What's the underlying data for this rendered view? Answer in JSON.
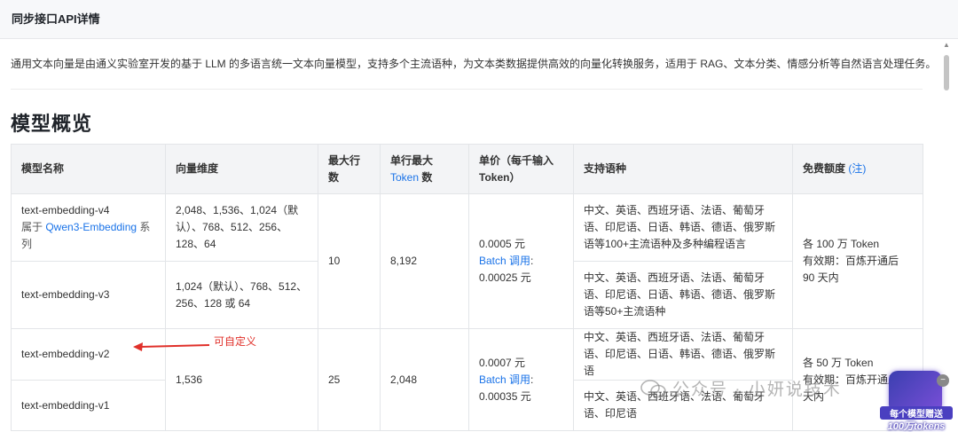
{
  "header": {
    "title": "同步接口API详情"
  },
  "intro": "通用文本向量是由通义实验室开发的基于 LLM 的多语言统一文本向量模型，支持多个主流语种，为文本类数据提供高效的向量化转换服务，适用于 RAG、文本分类、情感分析等自然语言处理任务。",
  "section_title": "模型概览",
  "table": {
    "headers": {
      "model": "模型名称",
      "dims": "向量维度",
      "max_rows": "最大行数",
      "max_tokens_pre": "单行最大",
      "max_tokens_link": "Token",
      "max_tokens_post": " 数",
      "price": "单价（每千输入 Token）",
      "langs": "支持语种",
      "quota_pre": "免费额度",
      "quota_link": "(注)"
    },
    "v4": {
      "name": "text-embedding-v4",
      "belongs_pre": "属于 ",
      "belongs_link": "Qwen3-Embedding",
      "belongs_post": " 系列",
      "dims": "2,048、1,536、1,024（默认）、768、512、256、128、64",
      "langs": "中文、英语、西班牙语、法语、葡萄牙语、印尼语、日语、韩语、德语、俄罗斯语等100+主流语种及多种编程语言"
    },
    "v3": {
      "name": "text-embedding-v3",
      "dims": "1,024（默认）、768、512、256、128 或 64",
      "langs": "中文、英语、西班牙语、法语、葡萄牙语、印尼语、日语、韩语、德语、俄罗斯语等50+主流语种"
    },
    "group1": {
      "max_rows": "10",
      "max_tokens": "8,192",
      "price": "0.0005 元",
      "batch_link": "Batch 调用",
      "batch_colon": ":",
      "batch_price": "0.00025 元",
      "quota": "各 100 万 Token",
      "valid": "有效期：百炼开通后 90 天内"
    },
    "v2": {
      "name": "text-embedding-v2",
      "langs": "中文、英语、西班牙语、法语、葡萄牙语、印尼语、日语、韩语、德语、俄罗斯语"
    },
    "v1": {
      "name": "text-embedding-v1",
      "langs": "中文、英语、西班牙语、法语、葡萄牙语、印尼语"
    },
    "group2": {
      "dims": "1,536",
      "max_rows": "25",
      "max_tokens": "2,048",
      "price": "0.0007 元",
      "batch_link": "Batch 调用",
      "batch_colon": ":",
      "batch_price": "0.00035 元",
      "quota": "各 50 万 Token",
      "valid": "有效期：百炼开通后",
      "valid2": "天内"
    }
  },
  "annotation": {
    "text": "可自定义",
    "color": "#e0302a"
  },
  "watermark": {
    "text": "公众号 · 小妍说技术"
  },
  "promo": {
    "line1": "每个模型赠送",
    "line2": "100万tokens"
  },
  "colors": {
    "link": "#1a73e8",
    "header_bg": "#f3f4f6",
    "border": "#e3e5e8"
  }
}
